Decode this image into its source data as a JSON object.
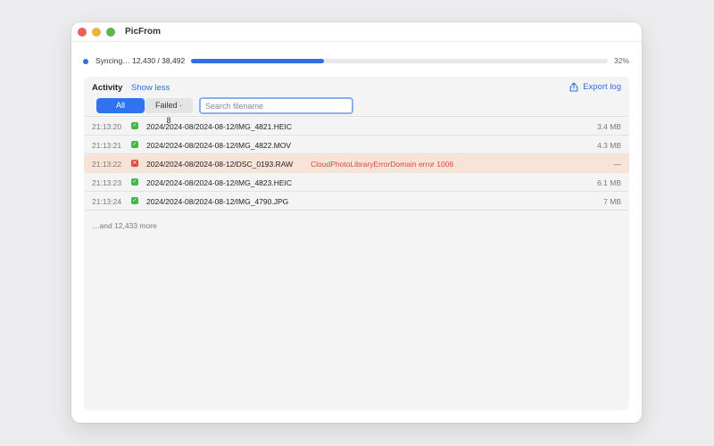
{
  "window": {
    "title": "PicFrom"
  },
  "sync": {
    "label": "Syncing… 12,430 / 38,492",
    "progress_percent": 32,
    "progress_text": "32%",
    "accent": "#2f6fe0"
  },
  "activity": {
    "title": "Activity",
    "show_less": "Show less",
    "export_label": "Export log",
    "filters": {
      "all": "All",
      "failed": "Failed · 8"
    },
    "search_placeholder": "Search filename",
    "rows": [
      {
        "time": "21:13:20",
        "status": "ok",
        "path": "2024/2024-08/2024-08-12/IMG_4821.HEIC",
        "error": "",
        "size": "3.4 MB"
      },
      {
        "time": "21:13:21",
        "status": "ok",
        "path": "2024/2024-08/2024-08-12/IMG_4822.MOV",
        "error": "",
        "size": "4.3 MB"
      },
      {
        "time": "21:13:22",
        "status": "fail",
        "path": "2024/2024-08/2024-08-12/DSC_0193.RAW",
        "error": "CloudPhotoLibraryErrorDomain error 1006",
        "size": "—"
      },
      {
        "time": "21:13:23",
        "status": "ok",
        "path": "2024/2024-08/2024-08-12/IMG_4823.HEIC",
        "error": "",
        "size": "6.1 MB"
      },
      {
        "time": "21:13:24",
        "status": "ok",
        "path": "2024/2024-08/2024-08-12/IMG_4790.JPG",
        "error": "",
        "size": "7 MB"
      }
    ],
    "more_text": "…and 12,433 more"
  }
}
